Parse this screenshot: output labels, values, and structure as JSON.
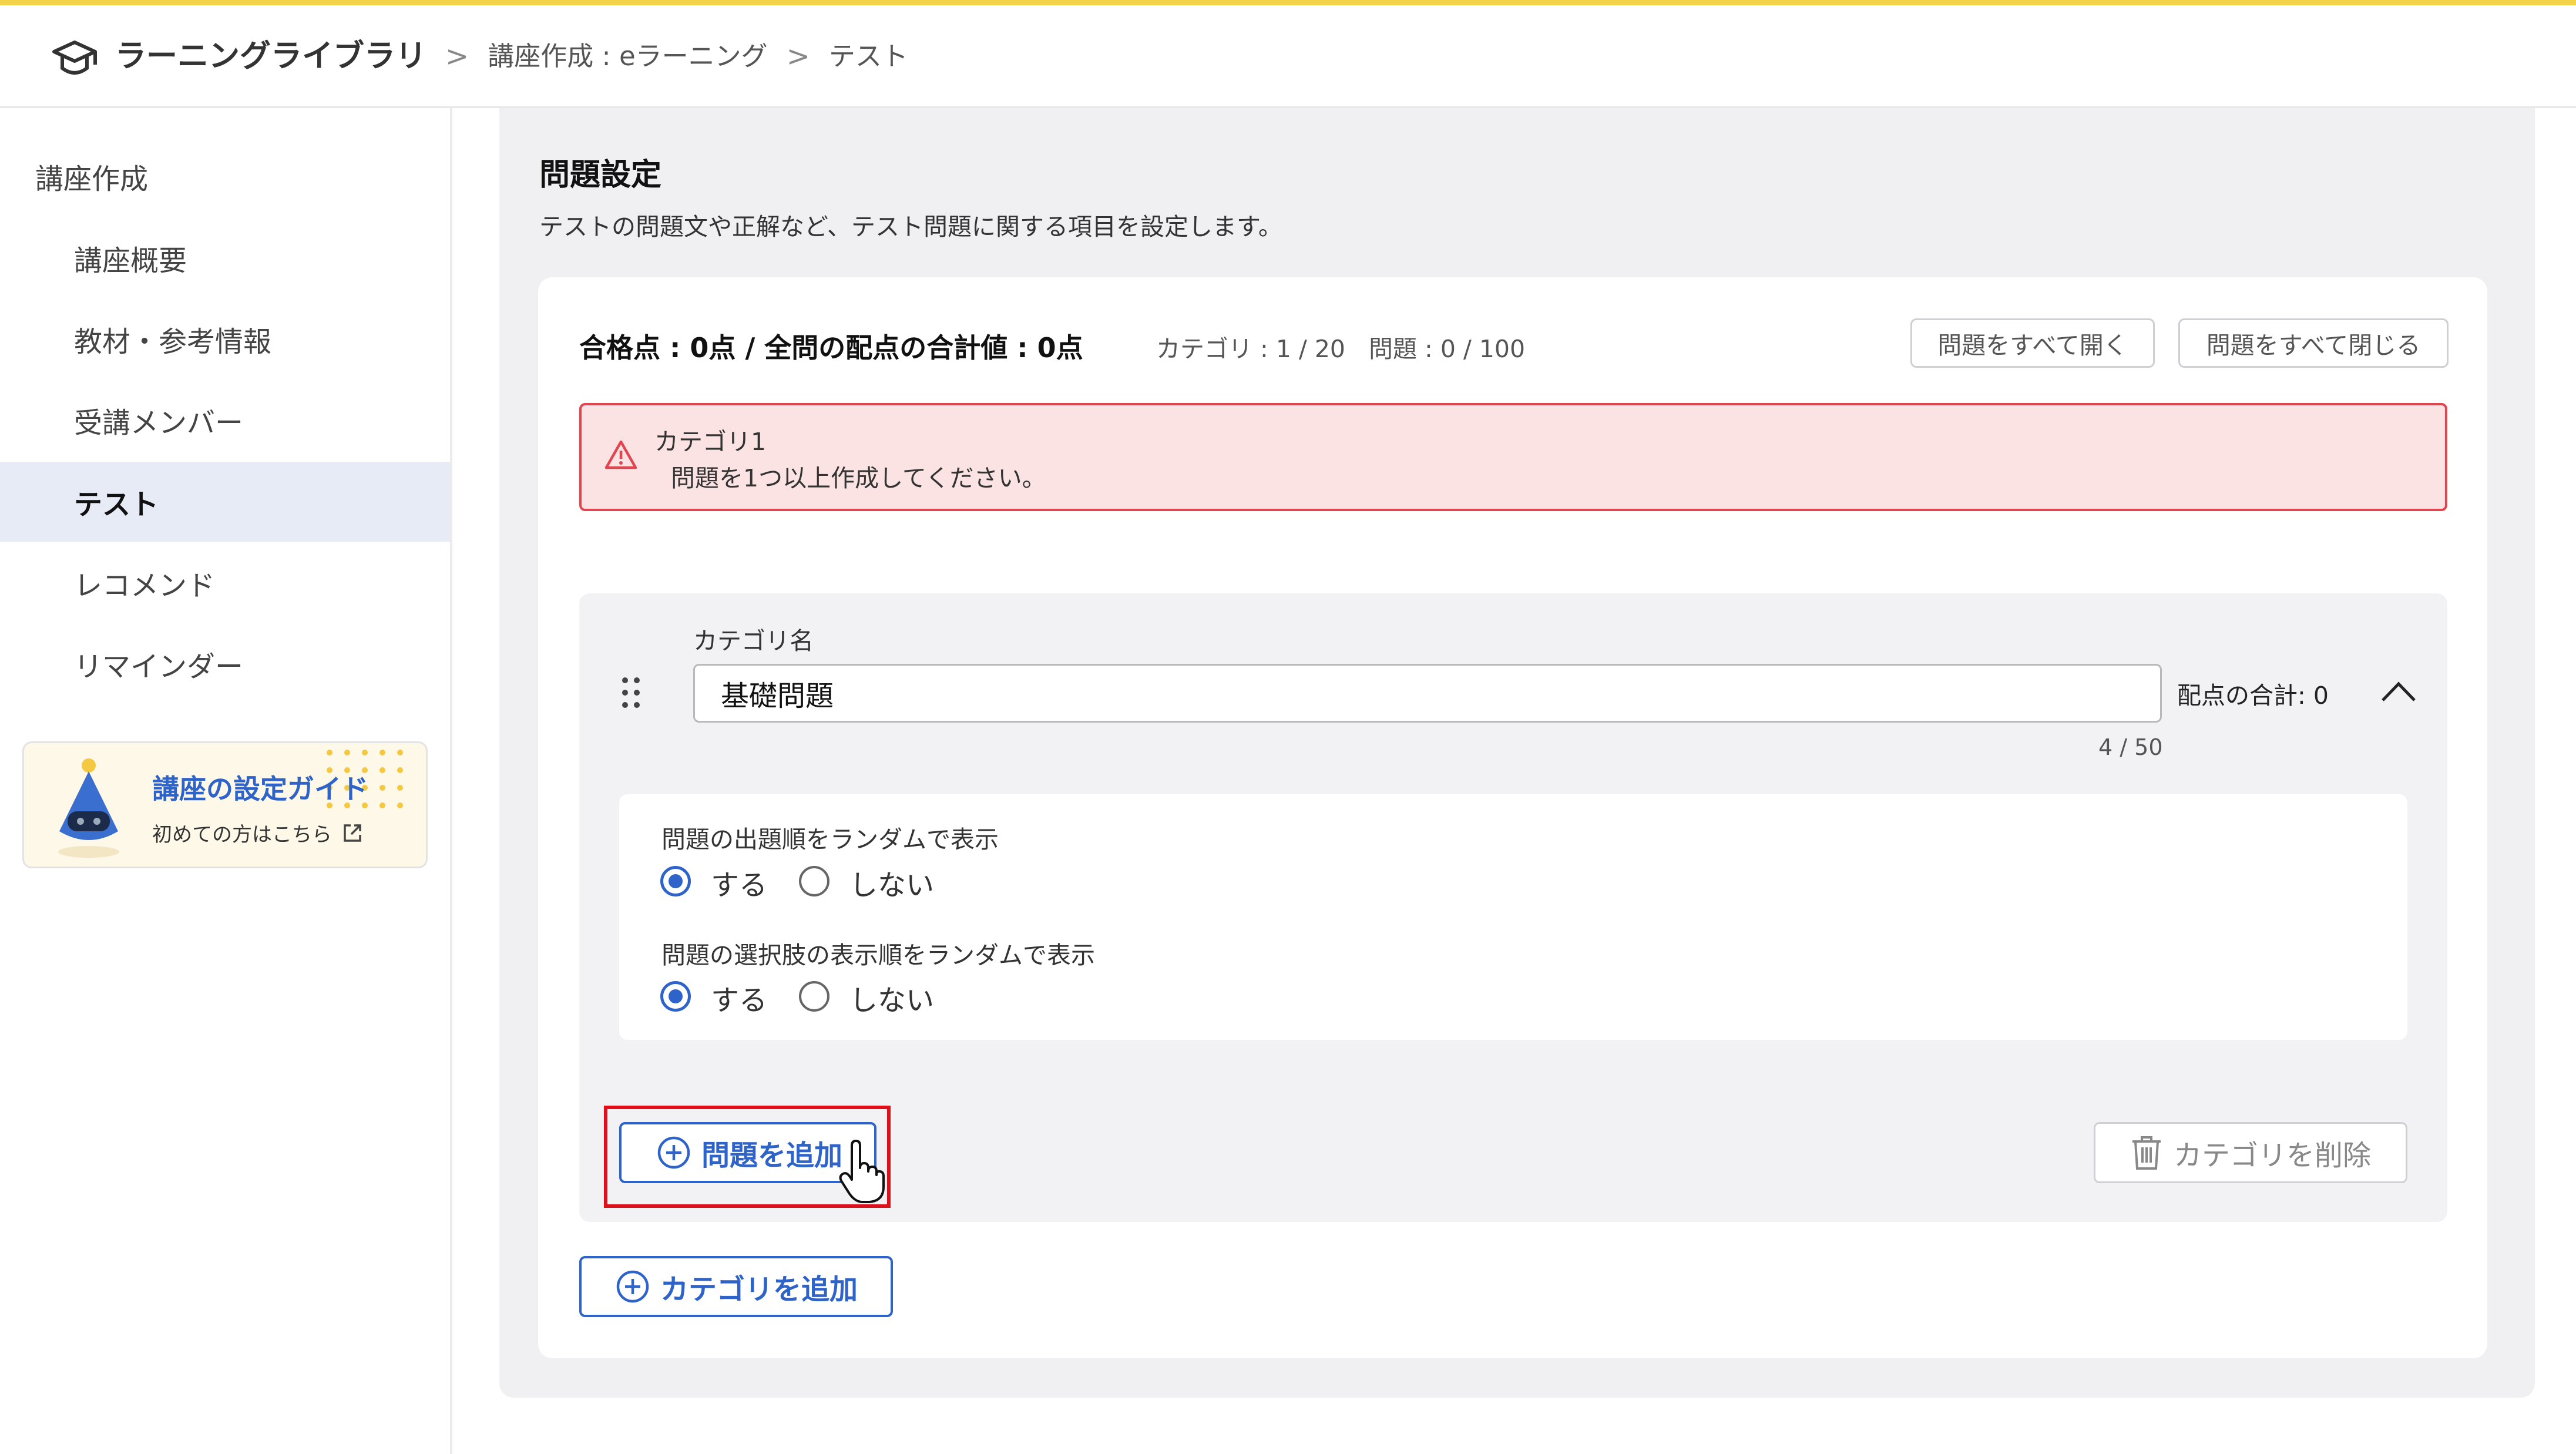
{
  "breadcrumb": {
    "home": "ラーニングライブラリ",
    "sep": ">",
    "course": "講座作成 : eラーニング",
    "current": "テスト"
  },
  "sidebar": {
    "heading": "講座作成",
    "items": [
      {
        "label": "講座概要"
      },
      {
        "label": "教材・参考情報"
      },
      {
        "label": "受講メンバー"
      },
      {
        "label": "テスト"
      },
      {
        "label": "レコメンド"
      },
      {
        "label": "リマインダー"
      }
    ],
    "guide": {
      "title": "講座の設定ガイド",
      "subtitle": "初めての方はこちら"
    }
  },
  "section": {
    "title": "問題設定",
    "description": "テストの問題文や正解など、テスト問題に関する項目を設定します。"
  },
  "stats": {
    "main": "合格点 : 0点 / 全問の配点の合計値 : 0点",
    "categories": "カテゴリ : 1 / 20",
    "questions": "問題 : 0 / 100"
  },
  "buttons": {
    "open_all": "問題をすべて開く",
    "close_all": "問題をすべて閉じる",
    "add_question": "問題を追加",
    "delete_category": "カテゴリを削除",
    "add_category": "カテゴリを追加"
  },
  "alert": {
    "title": "カテゴリ1",
    "message": "問題を1つ以上作成してください。"
  },
  "category": {
    "name_label": "カテゴリ名",
    "name_value": "基礎問題",
    "score_total": "配点の合計: 0",
    "char_count": "4 / 50"
  },
  "settings": {
    "random_order": {
      "label": "問題の出題順をランダムで表示",
      "yes": "する",
      "no": "しない",
      "selected": "yes"
    },
    "random_choices": {
      "label": "問題の選択肢の表示順をランダムで表示",
      "yes": "する",
      "no": "しない",
      "selected": "yes"
    }
  },
  "colors": {
    "accent": "#2e63c9",
    "alert_border": "#e0464f",
    "alert_bg": "#fbe3e3",
    "highlight": "#e0101a"
  }
}
